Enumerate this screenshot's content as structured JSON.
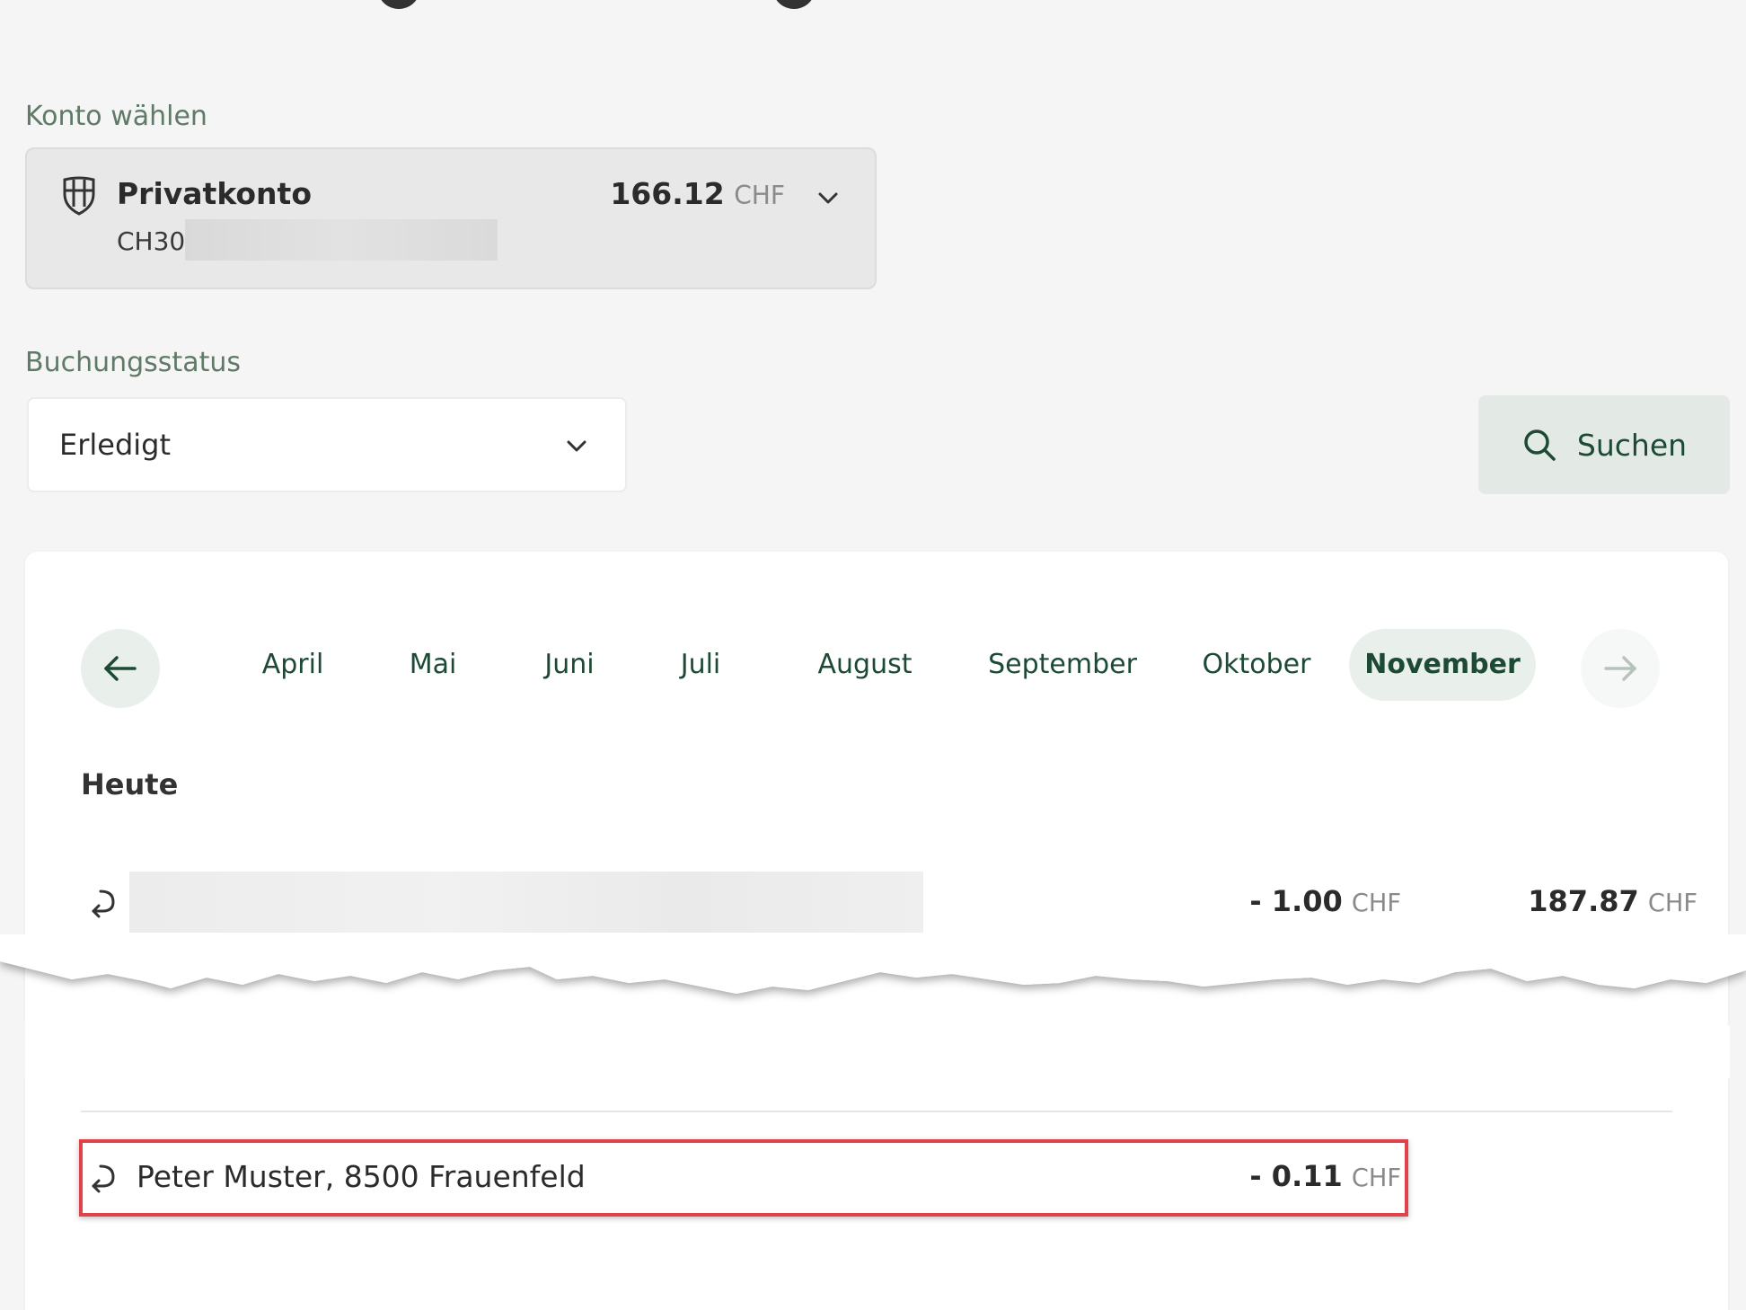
{
  "account_section": {
    "label": "Konto wählen",
    "account_name": "Privatkonto",
    "iban_prefix": "CH30",
    "balance_amount": "166.12",
    "balance_currency": "CHF"
  },
  "status_section": {
    "label": "Buchungsstatus",
    "selected_value": "Erledigt"
  },
  "search_button": {
    "label": "Suchen"
  },
  "months": [
    {
      "label": "April",
      "active": false
    },
    {
      "label": "Mai",
      "active": false
    },
    {
      "label": "Juni",
      "active": false
    },
    {
      "label": "Juli",
      "active": false
    },
    {
      "label": "August",
      "active": false
    },
    {
      "label": "September",
      "active": false
    },
    {
      "label": "Oktober",
      "active": false
    },
    {
      "label": "November",
      "active": true
    }
  ],
  "section_heading": "Heute",
  "transactions": [
    {
      "name": "",
      "amount": "- 1.00",
      "currency": "CHF",
      "balance": "187.87",
      "balance_currency": "CHF"
    },
    {
      "name": "Peter Muster, 8500 Frauenfeld",
      "amount": "- 0.11",
      "currency": "CHF"
    }
  ],
  "colors": {
    "accent_green": "#1d4a35",
    "label_green": "#5f7a66",
    "highlight_red": "#e0414b",
    "page_background": "#f5f5f5"
  },
  "icons": {
    "account": "shield-icon",
    "dropdown": "chevron-down-icon",
    "search": "search-icon",
    "previous": "arrow-left-icon",
    "next": "arrow-right-icon",
    "transaction": "return-arrow-icon"
  }
}
